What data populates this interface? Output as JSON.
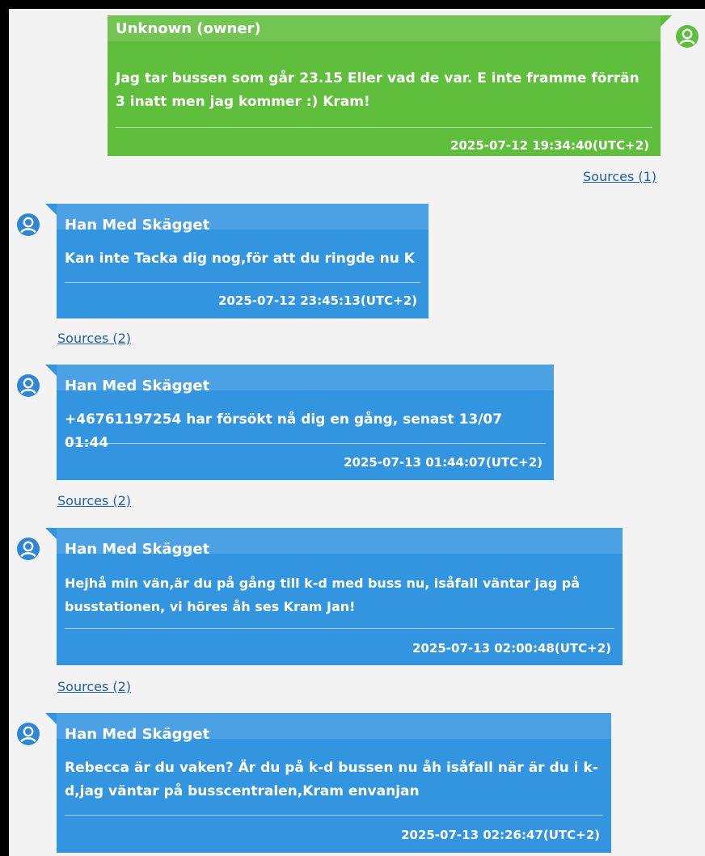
{
  "colors": {
    "owner_bubble": "#5fbe3c",
    "contact_bubble": "#3395e0",
    "owner_avatar": "#5fbe3c",
    "contact_avatar": "#2f86d6",
    "link": "#1f5fa8",
    "panel": "#f3f3f3"
  },
  "messages": [
    {
      "sender": "Unknown (owner)",
      "direction": "outgoing",
      "text": "Jag tar bussen som går 23.15 Eller vad de var. E inte framme förrän 3 inatt men jag kommer :) Kram!",
      "timestamp": "2025-07-12 19:34:40(UTC+2)",
      "sources": "Sources (1)",
      "avatar_icon": "user-avatar-icon"
    },
    {
      "sender": "Han Med Skägget",
      "direction": "incoming",
      "text": "Kan inte Tacka dig nog,för att du ringde nu K",
      "timestamp": "2025-07-12 23:45:13(UTC+2)",
      "sources": "Sources (2)",
      "avatar_icon": "user-avatar-icon"
    },
    {
      "sender": "Han Med Skägget",
      "direction": "incoming",
      "text": "+46761197254 har försökt nå dig en gång, senast 13/07 01:44",
      "timestamp": "2025-07-13 01:44:07(UTC+2)",
      "sources": "Sources (2)",
      "avatar_icon": "user-avatar-icon"
    },
    {
      "sender": "Han Med Skägget",
      "direction": "incoming",
      "text": "Hejhå min vän,är du på gång till k-d med buss nu, isåfall väntar jag på busstationen, vi höres åh ses Kram Jan!",
      "timestamp": "2025-07-13 02:00:48(UTC+2)",
      "sources": "Sources (2)",
      "avatar_icon": "user-avatar-icon"
    },
    {
      "sender": "Han Med Skägget",
      "direction": "incoming",
      "text": "Rebecca är du vaken? Är du på k-d bussen nu åh isåfall när är du i k-d,jag väntar på busscentralen,Kram envanjan",
      "timestamp": "2025-07-13 02:26:47(UTC+2)",
      "avatar_icon": "user-avatar-icon"
    }
  ]
}
